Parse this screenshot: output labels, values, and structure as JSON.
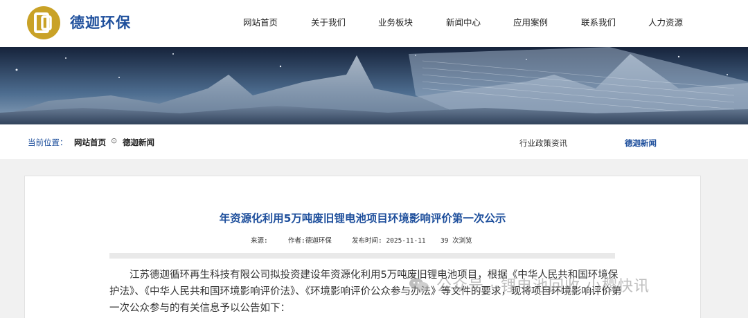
{
  "brand": {
    "name": "德迦环保",
    "logo_icon": "dj-logo-icon",
    "brand_color": "#1e4f9c",
    "logo_color": "#c9a227"
  },
  "nav": {
    "items": [
      {
        "label": "网站首页"
      },
      {
        "label": "关于我们"
      },
      {
        "label": "业务板块"
      },
      {
        "label": "新闻中心"
      },
      {
        "label": "应用案例"
      },
      {
        "label": "联系我们"
      },
      {
        "label": "人力资源"
      }
    ]
  },
  "breadcrumb": {
    "label": "当前位置：",
    "home": "网站首页",
    "separator": "⊙",
    "current": "德迦新闻"
  },
  "subnav": {
    "items": [
      {
        "label": "行业政策资讯"
      },
      {
        "label": "德迦新闻",
        "active": true
      }
    ]
  },
  "article": {
    "title": "年资源化利用5万吨废旧锂电池项目环境影响评价第一次公示",
    "meta": {
      "source": "来源:",
      "author": "作者:德迦环保",
      "published": "发布时间: 2025-11-11",
      "views": "39 次浏览"
    },
    "paragraph": "江苏德迦循环再生科技有限公司拟投资建设年资源化利用5万吨废旧锂电池项目，根据《中华人民共和国环境保护法》、《中华人民共和国环境影响评价法》、《环境影响评价公众参与办法》等文件的要求，现将项目环境影响评价第一次公众参与的有关信息予以公告如下："
  },
  "watermark": {
    "text": "公众号 · 锂电池回收 小樱快讯",
    "icon": "wechat-icon"
  }
}
